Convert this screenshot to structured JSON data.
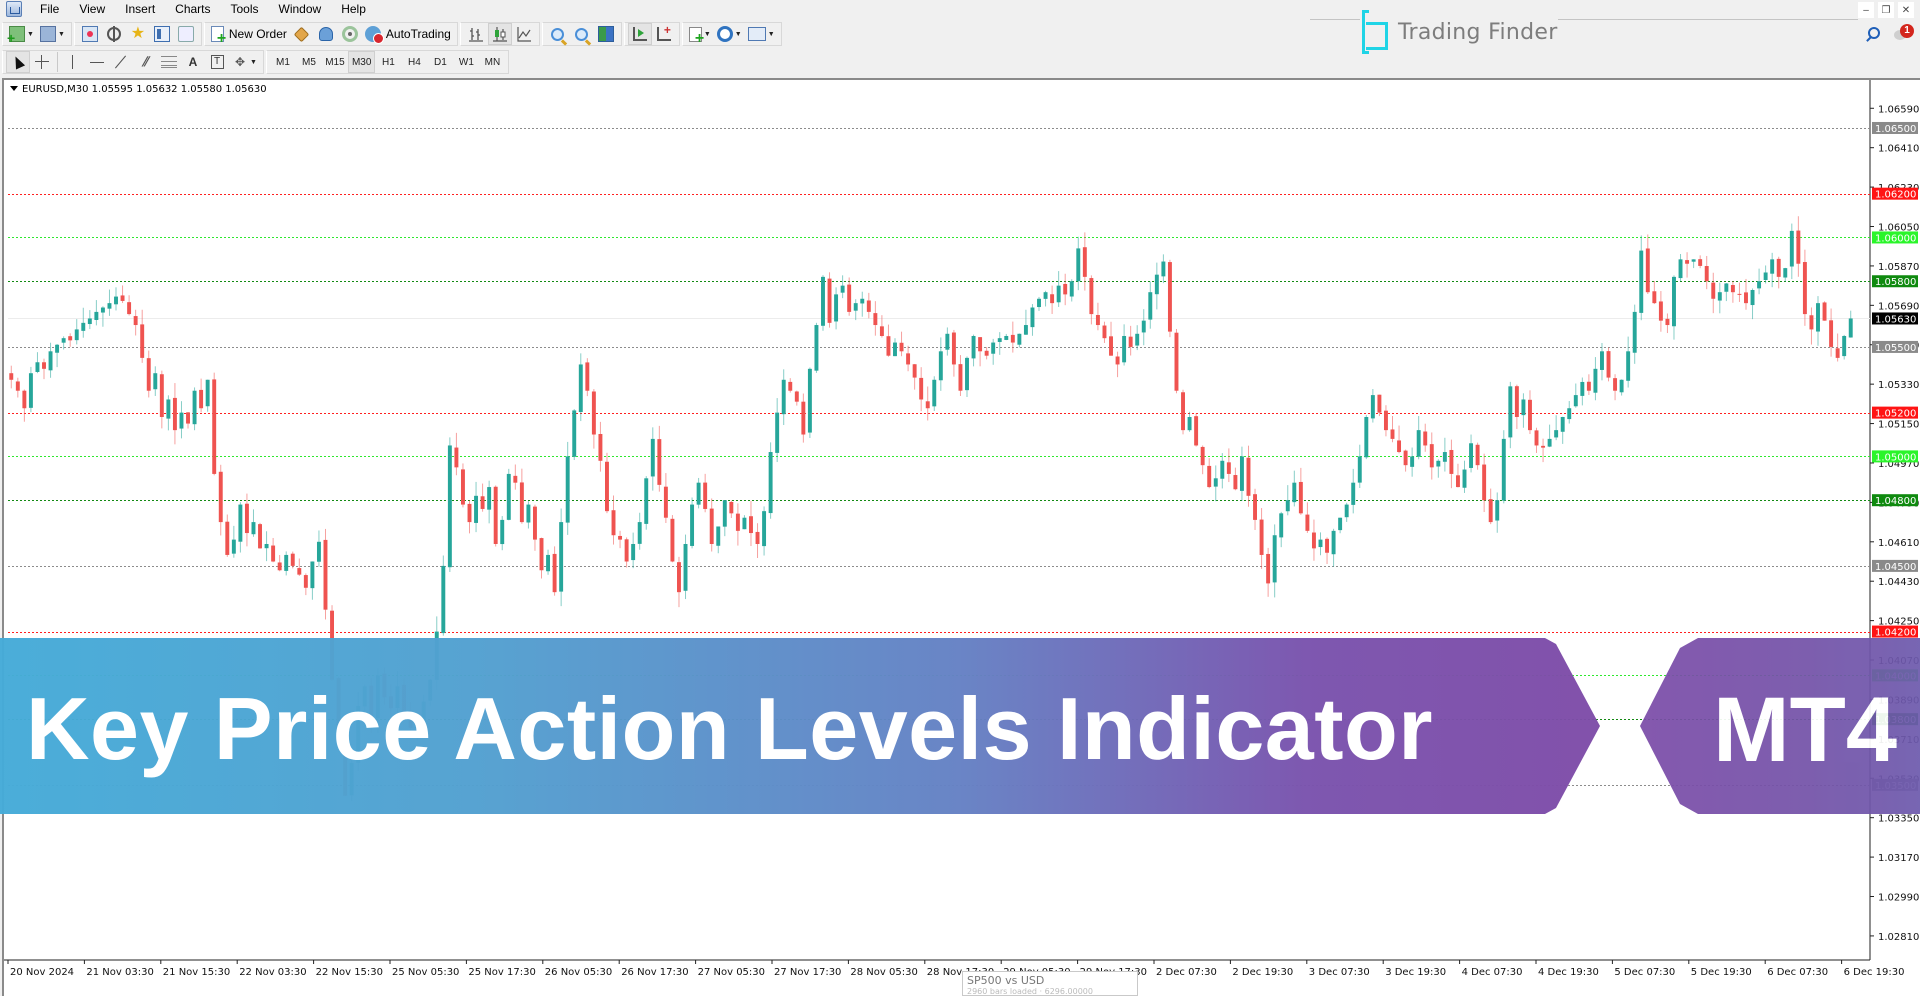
{
  "menu": {
    "items": [
      "File",
      "View",
      "Insert",
      "Charts",
      "Tools",
      "Window",
      "Help"
    ]
  },
  "toolbar": {
    "new_order_label": "New Order",
    "autotrading_label": "AutoTrading",
    "timeframes": [
      "M1",
      "M5",
      "M15",
      "M30",
      "H1",
      "H4",
      "D1",
      "W1",
      "MN"
    ],
    "active_timeframe": "M30"
  },
  "brand": {
    "name": "Trading Finder"
  },
  "window_controls": {
    "minimize": "‒",
    "restore": "❐",
    "close": "✕"
  },
  "notifications": {
    "count": "1"
  },
  "chart_window": {
    "header": "EURUSD,M30  1.05595 1.05632 1.05580 1.05630"
  },
  "banner": {
    "title": "Key Price Action Levels Indicator",
    "platform": "MT4"
  },
  "tooltip": {
    "title": "SP500 vs USD",
    "subtitle": "2960 bars loaded · 6296.00000"
  },
  "colors": {
    "bull": "#26a69a",
    "bear": "#ef5350",
    "level_gray": "#8c8c8c",
    "level_red": "#ff1f1f",
    "level_light_green": "#2ee82e",
    "level_dark_green": "#138a13",
    "banner_start": "#45abd8",
    "banner_end": "#7e4ca8"
  },
  "chart_data": {
    "type": "candlestick",
    "title": "EURUSD,M30",
    "symbol": "EURUSD",
    "timeframe": "M30",
    "ohlc_last": {
      "open": 1.05595,
      "high": 1.05632,
      "low": 1.0558,
      "close": 1.0563
    },
    "current_price": 1.0563,
    "ylim": [
      1.027,
      1.0671
    ],
    "y_ticks": [
      1.0659,
      1.0641,
      1.0623,
      1.0605,
      1.0587,
      1.0569,
      1.0551,
      1.0533,
      1.0515,
      1.0497,
      1.0479,
      1.0461,
      1.0443,
      1.0425,
      1.0407,
      1.0389,
      1.0371,
      1.0353,
      1.0335,
      1.0317,
      1.0299,
      1.0281
    ],
    "x_ticks": [
      "20 Nov 2024",
      "21 Nov 03:30",
      "21 Nov 15:30",
      "22 Nov 03:30",
      "22 Nov 15:30",
      "25 Nov 05:30",
      "25 Nov 17:30",
      "26 Nov 05:30",
      "26 Nov 17:30",
      "27 Nov 05:30",
      "27 Nov 17:30",
      "28 Nov 05:30",
      "28 Nov 17:30",
      "29 Nov 05:30",
      "29 Nov 17:30",
      "2 Dec 07:30",
      "2 Dec 19:30",
      "3 Dec 07:30",
      "3 Dec 19:30",
      "4 Dec 07:30",
      "4 Dec 19:30",
      "5 Dec 07:30",
      "5 Dec 19:30",
      "6 Dec 07:30",
      "6 Dec 19:30"
    ],
    "levels": [
      {
        "price": 1.065,
        "label": "1.06500",
        "kind": "gray"
      },
      {
        "price": 1.062,
        "label": "1.06200",
        "kind": "red"
      },
      {
        "price": 1.06,
        "label": "1.06000",
        "kind": "light_green"
      },
      {
        "price": 1.058,
        "label": "1.05800",
        "kind": "dark_green"
      },
      {
        "price": 1.055,
        "label": "1.05500",
        "kind": "gray"
      },
      {
        "price": 1.052,
        "label": "1.05200",
        "kind": "red"
      },
      {
        "price": 1.05,
        "label": "1.05000",
        "kind": "light_green"
      },
      {
        "price": 1.048,
        "label": "1.04800",
        "kind": "dark_green"
      },
      {
        "price": 1.045,
        "label": "1.04500",
        "kind": "gray"
      },
      {
        "price": 1.042,
        "label": "1.04200",
        "kind": "red"
      },
      {
        "price": 1.04,
        "label": "1.04000",
        "kind": "light_green"
      },
      {
        "price": 1.038,
        "label": "1.03800",
        "kind": "dark_green"
      },
      {
        "price": 1.035,
        "label": "1.03500",
        "kind": "gray"
      }
    ],
    "closes": [
      1.0535,
      1.053,
      1.0522,
      1.0538,
      1.0543,
      1.054,
      1.0548,
      1.0551,
      1.0554,
      1.0553,
      1.0558,
      1.0561,
      1.0563,
      1.0566,
      1.0568,
      1.057,
      1.0573,
      1.0571,
      1.0565,
      1.056,
      1.0545,
      1.053,
      1.0538,
      1.0518,
      1.0526,
      1.0512,
      1.052,
      1.0515,
      1.053,
      1.0522,
      1.0535,
      1.0492,
      1.047,
      1.0455,
      1.0462,
      1.0478,
      1.0465,
      1.047,
      1.0458,
      1.046,
      1.0452,
      1.0448,
      1.0455,
      1.045,
      1.0446,
      1.044,
      1.0452,
      1.0461,
      1.043,
      1.0398,
      1.0372,
      1.0345,
      1.036,
      1.0386,
      1.0395,
      1.038,
      1.04,
      1.039,
      1.0385,
      1.0395,
      1.0383,
      1.0376,
      1.0378,
      1.0388,
      1.0398,
      1.042,
      1.045,
      1.0505,
      1.0495,
      1.0478,
      1.047,
      1.0482,
      1.0476,
      1.0486,
      1.046,
      1.0471,
      1.0492,
      1.0488,
      1.047,
      1.0478,
      1.0462,
      1.0448,
      1.0455,
      1.0438,
      1.047,
      1.05,
      1.0521,
      1.0542,
      1.053,
      1.051,
      1.0498,
      1.0475,
      1.0464,
      1.0462,
      1.0452,
      1.046,
      1.047,
      1.049,
      1.0508,
      1.0487,
      1.0472,
      1.0452,
      1.0438,
      1.046,
      1.0478,
      1.0488,
      1.0476,
      1.046,
      1.0468,
      1.048,
      1.0474,
      1.0466,
      1.0472,
      1.0465,
      1.046,
      1.0475,
      1.0502,
      1.052,
      1.0535,
      1.053,
      1.0525,
      1.051,
      1.054,
      1.056,
      1.0582,
      1.0561,
      1.0574,
      1.0578,
      1.0566,
      1.057,
      1.0572,
      1.0566,
      1.056,
      1.0555,
      1.0546,
      1.0552,
      1.0548,
      1.0542,
      1.0536,
      1.0526,
      1.0522,
      1.0535,
      1.0548,
      1.0556,
      1.0542,
      1.053,
      1.0545,
      1.0555,
      1.0548,
      1.0546,
      1.0552,
      1.0554,
      1.0555,
      1.0552,
      1.0556,
      1.056,
      1.0568,
      1.0572,
      1.0575,
      1.057,
      1.0578,
      1.0574,
      1.058,
      1.0595,
      1.0582,
      1.0565,
      1.056,
      1.0554,
      1.0546,
      1.0542,
      1.0555,
      1.055,
      1.0556,
      1.0562,
      1.0575,
      1.0583,
      1.0589,
      1.0557,
      1.053,
      1.0512,
      1.0518,
      1.0505,
      1.0496,
      1.0486,
      1.049,
      1.0498,
      1.0492,
      1.0485,
      1.05,
      1.0482,
      1.0471,
      1.0455,
      1.0442,
      1.0464,
      1.0474,
      1.048,
      1.0488,
      1.0474,
      1.0466,
      1.0458,
      1.0462,
      1.0456,
      1.0466,
      1.0472,
      1.0478,
      1.0488,
      1.05,
      1.0518,
      1.0528,
      1.052,
      1.0512,
      1.0508,
      1.0502,
      1.0496,
      1.05,
      1.0512,
      1.0505,
      1.0495,
      1.0498,
      1.0502,
      1.0492,
      1.0486,
      1.0494,
      1.0506,
      1.0496,
      1.048,
      1.047,
      1.048,
      1.0508,
      1.0532,
      1.0518,
      1.0526,
      1.0512,
      1.0505,
      1.0504,
      1.0508,
      1.0512,
      1.0518,
      1.0522,
      1.0528,
      1.0534,
      1.053,
      1.054,
      1.0548,
      1.0536,
      1.053,
      1.0535,
      1.0548,
      1.0566,
      1.0594,
      1.0575,
      1.057,
      1.0562,
      1.056,
      1.0582,
      1.059,
      1.0588,
      1.059,
      1.0587,
      1.058,
      1.0572,
      1.0575,
      1.0579,
      1.0575,
      1.0574,
      1.057,
      1.0576,
      1.058,
      1.0584,
      1.059,
      1.0582,
      1.0586,
      1.0603,
      1.0588,
      1.0565,
      1.0558,
      1.057,
      1.0562,
      1.055,
      1.0545,
      1.0555,
      1.0563
    ]
  }
}
